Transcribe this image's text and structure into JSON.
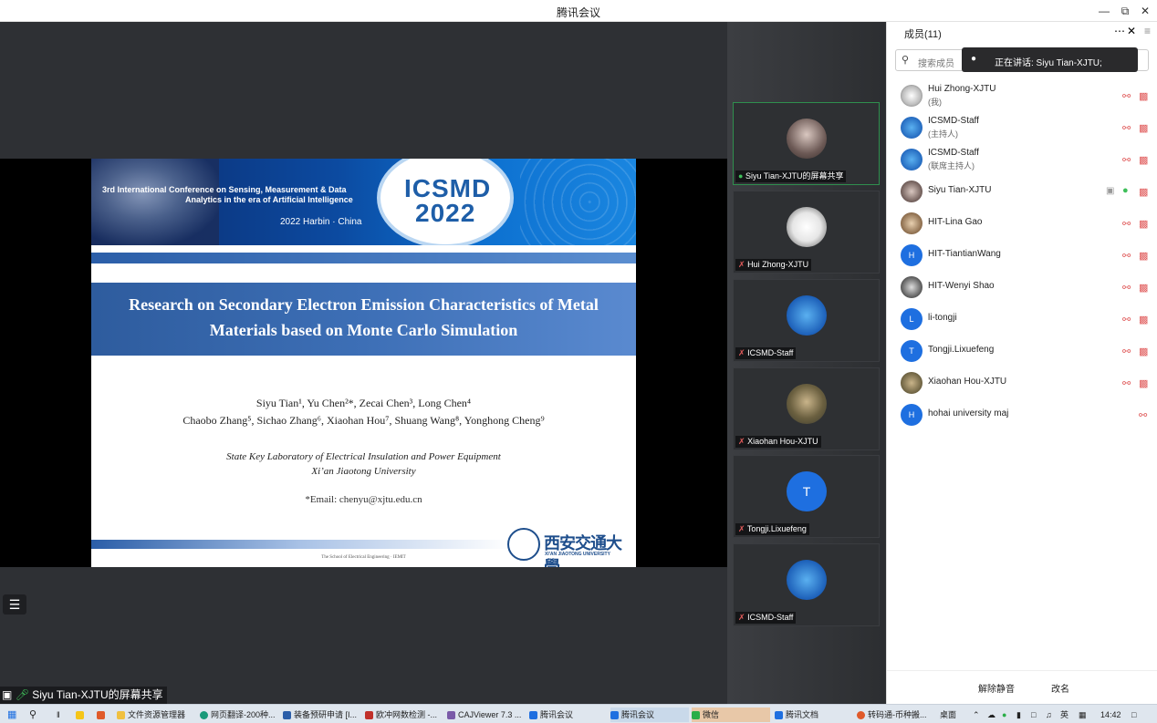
{
  "window": {
    "title": "腾讯会议"
  },
  "slide": {
    "conf_line1": "3rd International Conference on Sensing, Measurement & Data",
    "conf_line2": "Analytics in the era of Artificial Intelligence",
    "conf_location": "2022 Harbin · China",
    "badge_line1": "ICSMD",
    "badge_line2": "2022",
    "title_line1": "Research on Secondary Electron Emission Characteristics of Metal",
    "title_line2": "Materials based on Monte Carlo Simulation",
    "authors_line1": "Siyu Tian¹, Yu Chen²*, Zecai Chen³, Long Chen⁴",
    "authors_line2": "Chaobo Zhang⁵, Sichao Zhang⁶, Xiaohan Hou⁷, Shuang Wang⁸, Yonghong Cheng⁹",
    "affil_line1": "State Key Laboratory of Electrical Insulation and Power Equipment",
    "affil_line2": "Xi’an Jiaotong University",
    "email": "*Email: chenyu@xjtu.edu.cn",
    "school": "The School of Electrical Engineering · IEMIT",
    "logo_cn": "西安交通大學",
    "logo_en": "XI'AN JIAOTONG UNIVERSITY"
  },
  "share_label": "Siyu Tian-XJTU的屏幕共享",
  "tiles": [
    {
      "name": "Siyu Tian-XJTU的屏幕共享"
    },
    {
      "name": "Hui Zhong-XJTU"
    },
    {
      "name": "ICSMD-Staff"
    },
    {
      "name": "Xiaohan Hou-XJTU"
    },
    {
      "name": "Tongji.Lixuefeng",
      "initial": "T"
    },
    {
      "name": "ICSMD-Staff"
    }
  ],
  "panel": {
    "title": "成员(11)",
    "search_placeholder": "搜索成员",
    "speaking": "正在讲话: Siyu Tian-XJTU;",
    "members": [
      {
        "name": "Hui Zhong-XJTU",
        "role": "(我)",
        "initial": ""
      },
      {
        "name": "ICSMD-Staff",
        "role": "(主持人)",
        "initial": ""
      },
      {
        "name": "ICSMD-Staff",
        "role": "(联席主持人)",
        "initial": ""
      },
      {
        "name": "Siyu Tian-XJTU",
        "role": "",
        "initial": ""
      },
      {
        "name": "HIT-Lina Gao",
        "role": "",
        "initial": ""
      },
      {
        "name": "HIT-TiantianWang",
        "role": "",
        "initial": "H"
      },
      {
        "name": "HIT-Wenyi Shao",
        "role": "",
        "initial": ""
      },
      {
        "name": "li-tongji",
        "role": "",
        "initial": "L"
      },
      {
        "name": "Tongji.Lixuefeng",
        "role": "",
        "initial": "T"
      },
      {
        "name": "Xiaohan Hou-XJTU",
        "role": "",
        "initial": ""
      },
      {
        "name": "hohai university maj",
        "role": "",
        "initial": "H"
      }
    ],
    "unmute_all": "解除静音",
    "rename": "改名"
  },
  "taskbar": {
    "items": [
      "文件资源管理器",
      "网页翻译-200种...",
      "装备预研申请 [I...",
      "欧冲网数检测 -...",
      "CAJViewer 7.3 ...",
      "腾讯会议",
      "腾讯会议",
      "微信",
      "腾讯文档",
      "转码通-币种搬..."
    ],
    "desktop": "桌面",
    "ime": "英",
    "time": "14:42"
  },
  "colors": {
    "accent": "#1e6fe0",
    "mic_muted": "#e05a5a",
    "mic_active": "#3fbf5a"
  }
}
